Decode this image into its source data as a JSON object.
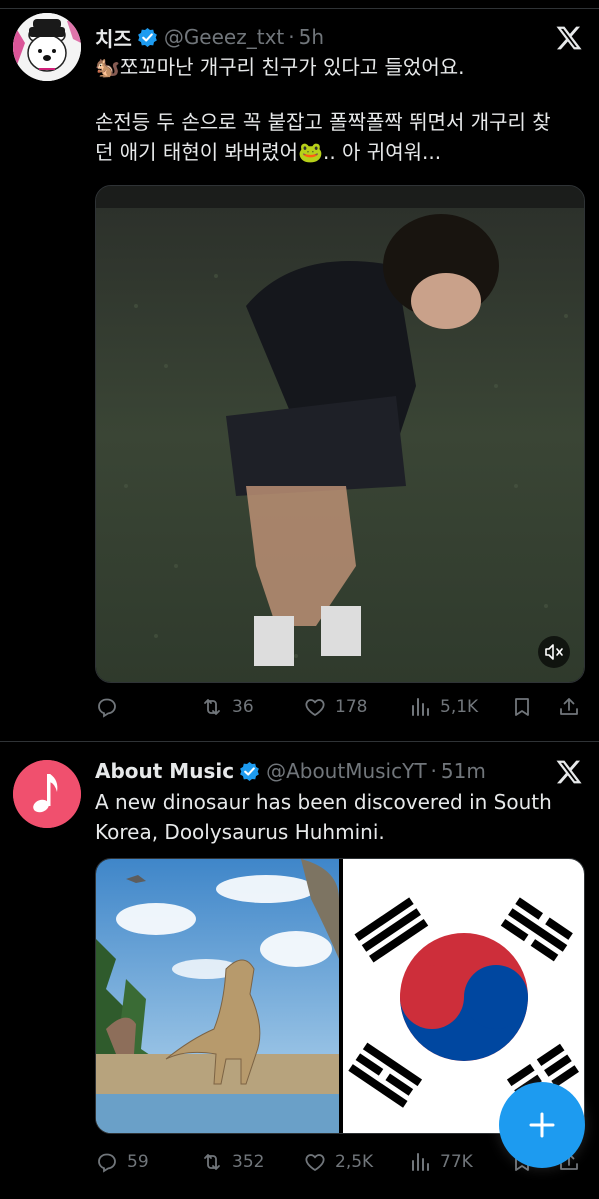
{
  "tweets": [
    {
      "name": "치즈",
      "handle": "@Geeez_txt",
      "separator": "·",
      "time": "5h",
      "text_lines": [
        "🐿️쪼꼬마난 개구리 친구가 있다고 들었어요.",
        "",
        "손전등 두 손으로 꼭 붙잡고 폴짝폴짝 뛰면서 개구리 찾",
        "던 애기 태현이 봐버렸어🐸.. 아 귀여워..."
      ],
      "media": {
        "type": "video",
        "muted_icon": "mute-icon"
      },
      "actions": {
        "replies": "",
        "reposts": "36",
        "likes": "178",
        "views": "5,1K"
      }
    },
    {
      "name": "About Music",
      "handle": "@AboutMusicYT",
      "separator": "·",
      "time": "51m",
      "text_lines": [
        "A new dinosaur has been discovered in South",
        "Korea, Doolysaurus Huhmini."
      ],
      "media": {
        "type": "image-grid",
        "images": [
          "dinosaur-illustration",
          "south-korea-flag"
        ]
      },
      "actions": {
        "replies": "59",
        "reposts": "352",
        "likes": "2,5K",
        "views": "77K"
      }
    }
  ],
  "colors": {
    "background": "#000000",
    "text": "#e7e9ea",
    "muted": "#71767b",
    "accent": "#1d9bf0",
    "music_avatar": "#f0506e"
  },
  "icons": [
    "verified-icon",
    "x-logo-icon",
    "reply-icon",
    "repost-icon",
    "like-icon",
    "views-icon",
    "bookmark-icon",
    "share-icon",
    "compose-plus-icon"
  ]
}
